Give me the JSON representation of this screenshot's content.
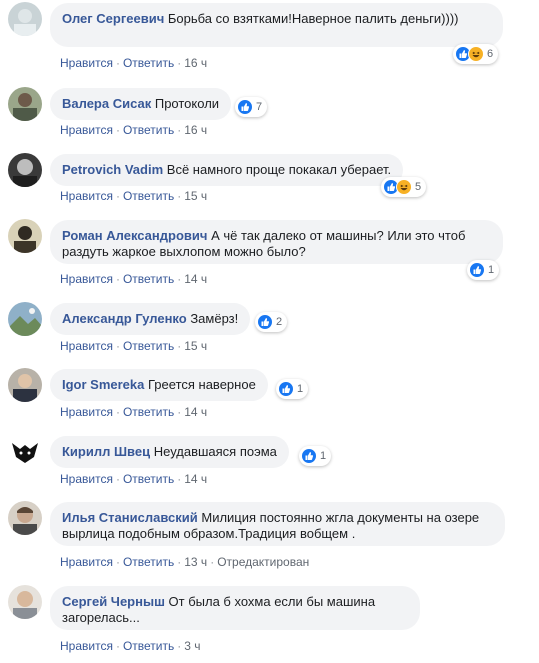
{
  "ui": {
    "like_label": "Нравится",
    "reply_label": "Ответить",
    "separator": "·"
  },
  "colors": {
    "link": "#385898",
    "bubble": "#f2f3f5",
    "like": "#1877f2",
    "haha": "#f7b125"
  },
  "comments": [
    {
      "author": "Олег Сергеевич",
      "text": "Борьба со взятками!Наверное палить деньги))))",
      "reactions": [
        "like-icon",
        "haha-icon"
      ],
      "reaction_count": "6",
      "time": "16 ч"
    },
    {
      "author": "Валера Сисак",
      "text": "Протоколи",
      "reactions": [
        "like-icon"
      ],
      "reaction_count": "7",
      "time": "16 ч"
    },
    {
      "author": "Petrovich Vadim",
      "text": "Всё намного проще покакал уберает.",
      "reactions": [
        "like-icon",
        "haha-icon"
      ],
      "reaction_count": "5",
      "time": "15 ч"
    },
    {
      "author": "Роман Александрович",
      "text": "А чё так далеко от машины? Или это чтоб раздуть жаркое выхлопом можно было?",
      "reactions": [
        "like-icon"
      ],
      "reaction_count": "1",
      "time": "14 ч"
    },
    {
      "author": "Александр Гуленко",
      "text": "Замёрз!",
      "reactions": [
        "like-icon"
      ],
      "reaction_count": "2",
      "time": "15 ч"
    },
    {
      "author": "Igor Smereka",
      "text": "Греется наверное",
      "reactions": [
        "like-icon"
      ],
      "reaction_count": "1",
      "time": "14 ч"
    },
    {
      "author": "Кирилл Швец",
      "text": "Неудавшаяся поэма",
      "reactions": [
        "like-icon"
      ],
      "reaction_count": "1",
      "time": "14 ч"
    },
    {
      "author": "Илья Станиславский",
      "text": "Милиция постоянно жгла документы на озере вырлица подобным образом.Традиция вобщем .",
      "time": "13 ч",
      "edited": "Отредактирован"
    },
    {
      "author": "Сергей Черныш",
      "text": "От была б хохма если бы машина загорелась...",
      "time": "3 ч"
    }
  ]
}
